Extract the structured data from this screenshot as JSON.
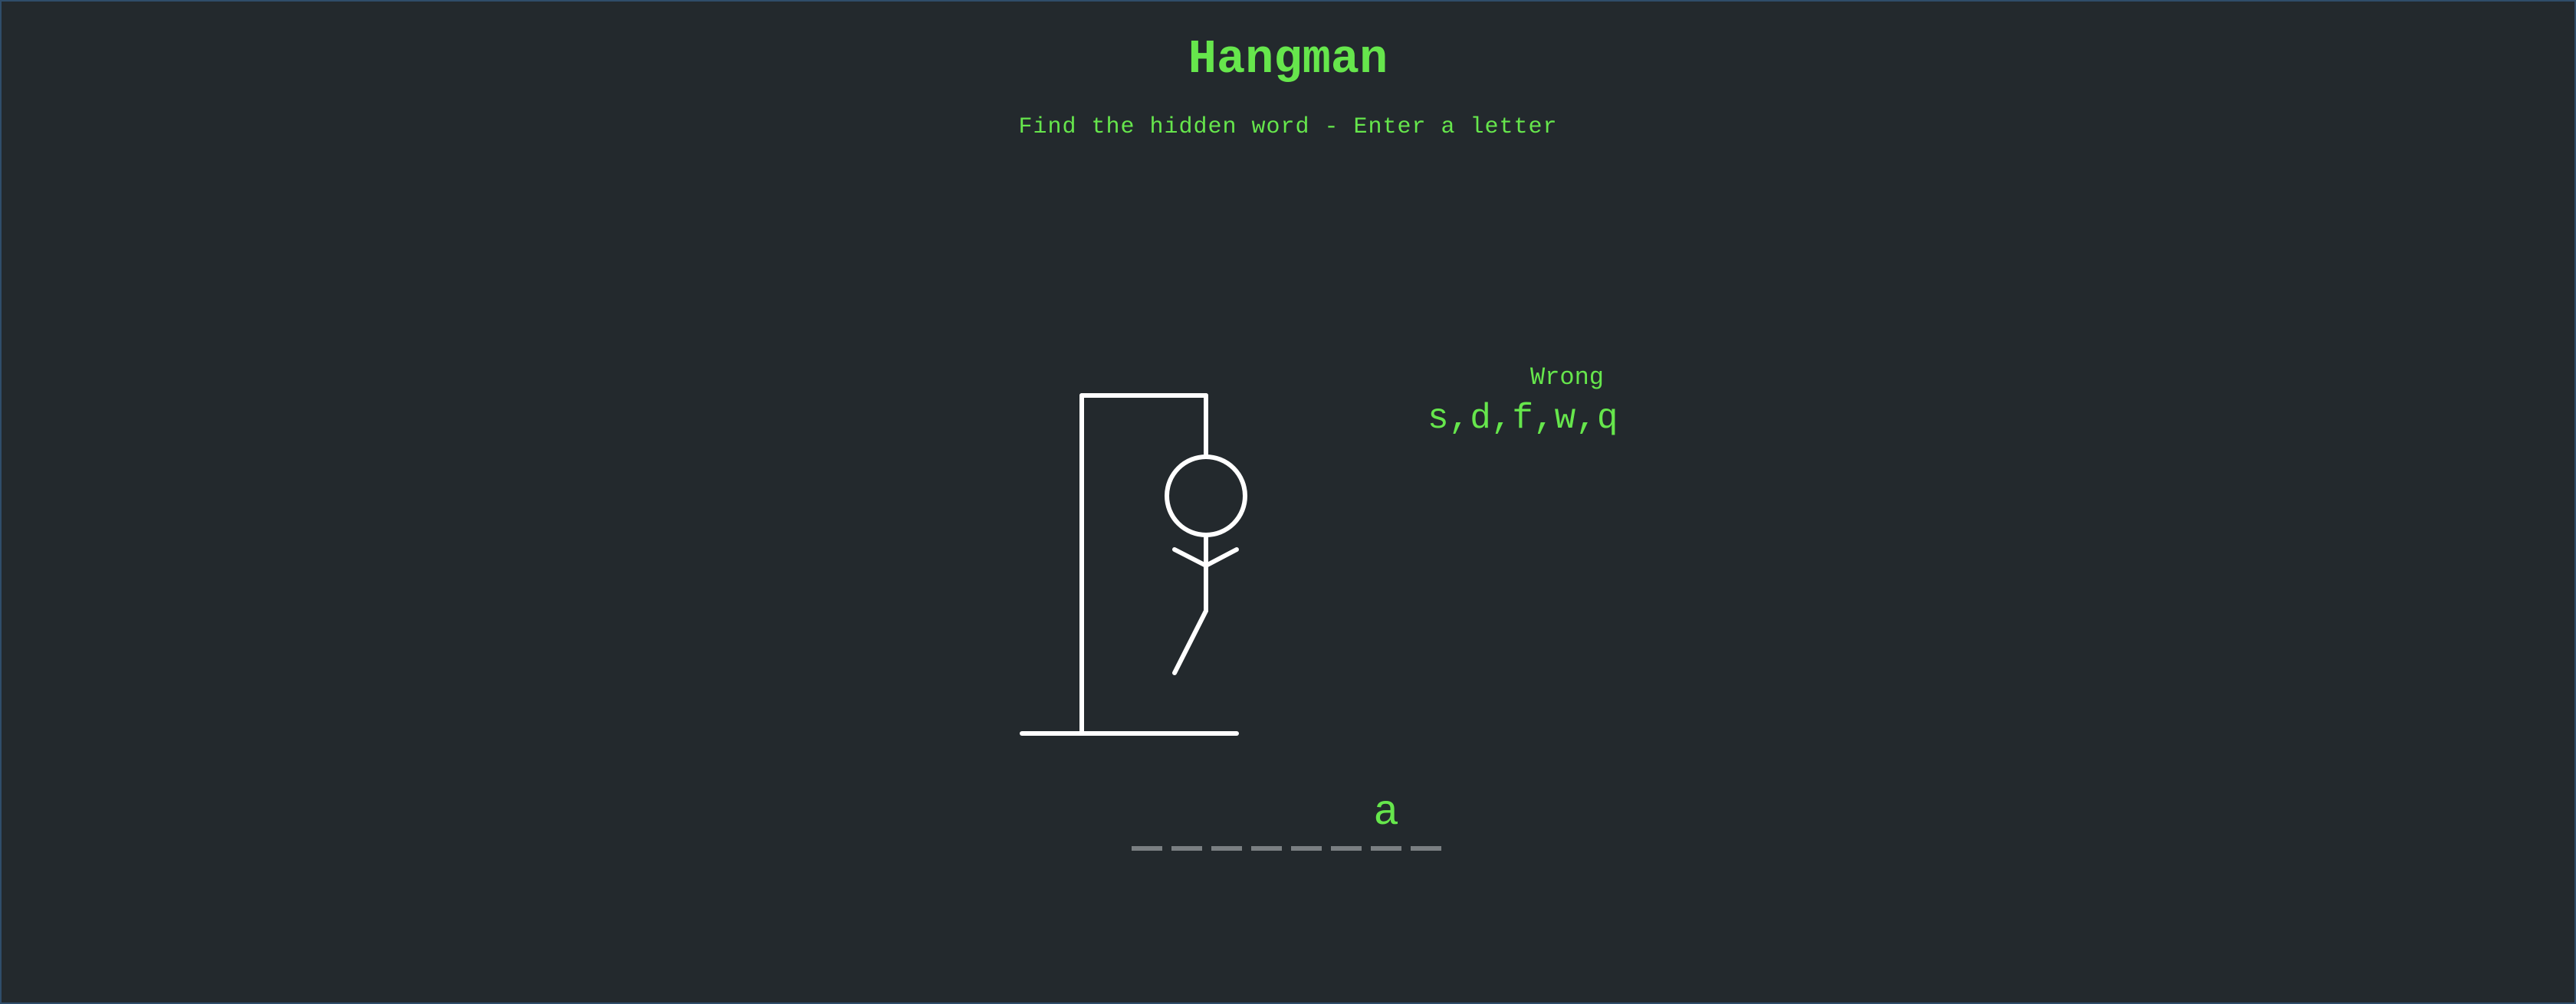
{
  "header": {
    "title": "Hangman",
    "instruction": "Find the hidden word - Enter a letter"
  },
  "wrong": {
    "label": "Wrong",
    "letters": "s,d,f,w,q"
  },
  "word": {
    "slots": [
      "",
      "",
      "",
      "",
      "",
      "",
      "a",
      ""
    ]
  },
  "figure": {
    "wrong_count": 5,
    "max_wrong": 6,
    "shown_parts": [
      "head",
      "body",
      "left-arm",
      "right-arm",
      "left-leg"
    ]
  },
  "colors": {
    "background": "#23292d",
    "accent": "#66e64c",
    "drawing": "#ffffff",
    "underline": "#7a7f82"
  }
}
